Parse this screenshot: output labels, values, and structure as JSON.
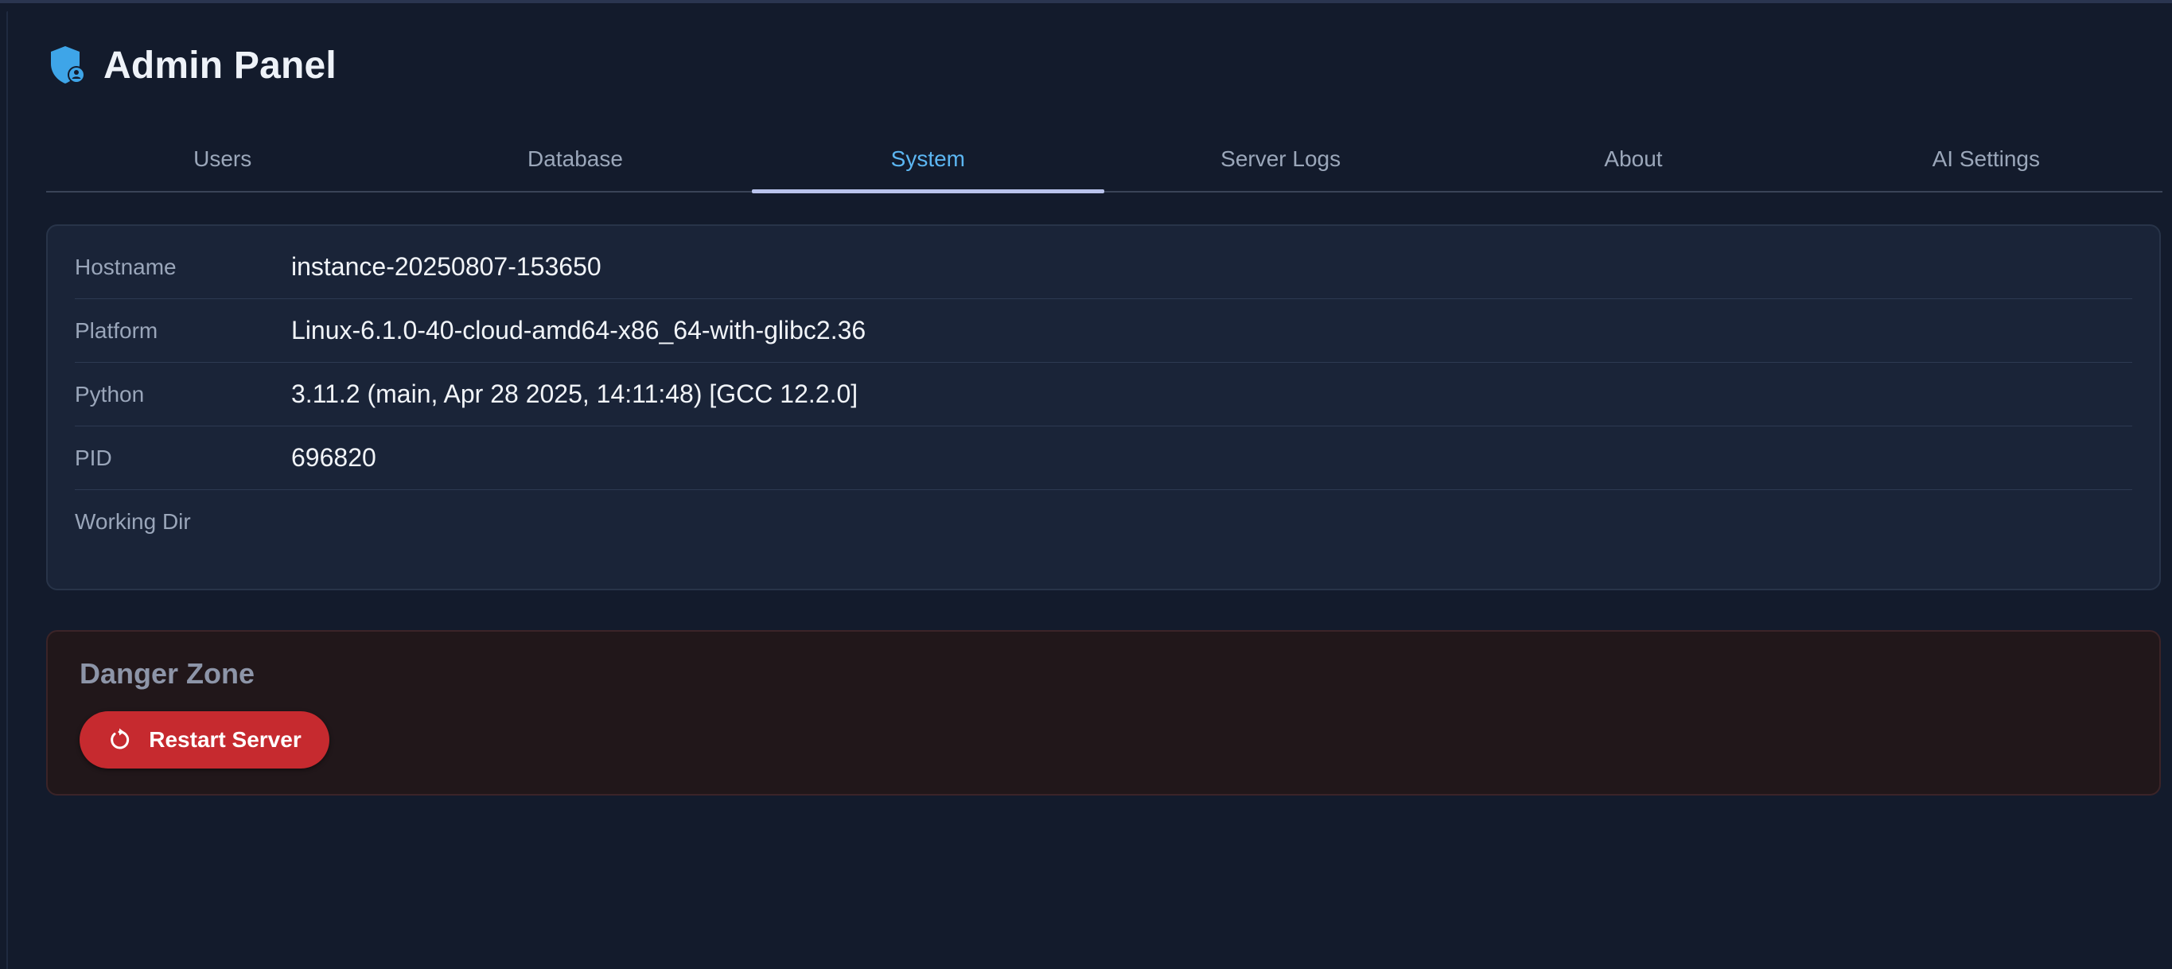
{
  "app": {
    "title": "Admin Panel",
    "icon": "shield-person-icon",
    "accent_color": "#5cb6f2"
  },
  "tabs": [
    {
      "label": "Users",
      "active": false
    },
    {
      "label": "Database",
      "active": false
    },
    {
      "label": "System",
      "active": true
    },
    {
      "label": "Server Logs",
      "active": false
    },
    {
      "label": "About",
      "active": false
    },
    {
      "label": "AI Settings",
      "active": false
    }
  ],
  "system_info": {
    "rows": [
      {
        "label": "Hostname",
        "value": "instance-20250807-153650"
      },
      {
        "label": "Platform",
        "value": "Linux-6.1.0-40-cloud-amd64-x86_64-with-glibc2.36"
      },
      {
        "label": "Python",
        "value": "3.11.2 (main, Apr 28 2025, 14:11:48) [GCC 12.2.0]"
      },
      {
        "label": "PID",
        "value": "696820"
      },
      {
        "label": "Working Dir",
        "value": ""
      }
    ]
  },
  "danger_zone": {
    "title": "Danger Zone",
    "restart_button": {
      "label": "Restart Server",
      "icon": "restart-icon",
      "color": "#c62a2f"
    }
  }
}
